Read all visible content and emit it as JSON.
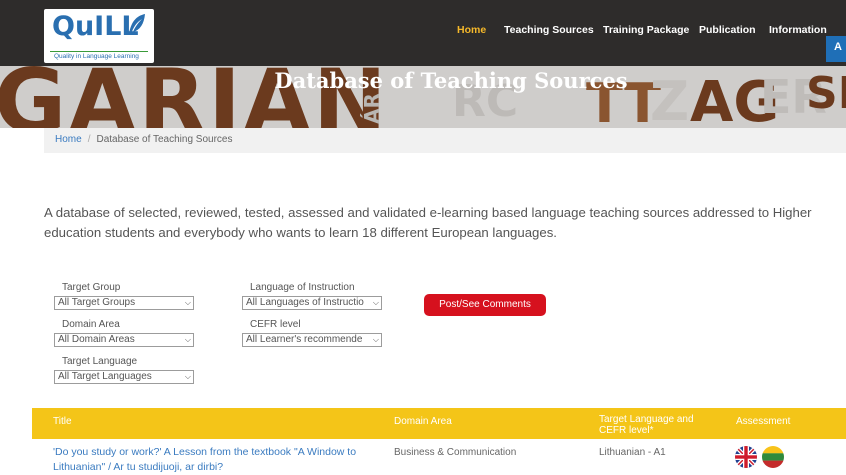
{
  "logo": {
    "name": "QuILL",
    "tagline": "Quality in Language Learning"
  },
  "nav": {
    "items": [
      {
        "label": "Home",
        "active": true
      },
      {
        "label": "Teaching Sources",
        "active": false
      },
      {
        "label": "Training Package",
        "active": false
      },
      {
        "label": "Publication",
        "active": false
      },
      {
        "label": "Information",
        "active": false
      }
    ],
    "login_label": "A"
  },
  "banner": {
    "title": "Database of Teaching Sources",
    "background_text": "GARIAN"
  },
  "breadcrumb": {
    "home": "Home",
    "separator": "/",
    "current": "Database of Teaching Sources"
  },
  "intro": "A database of selected, reviewed, tested, assessed and validated e-learning based language teaching sources addressed to Higher education students and everybody who wants to learn 18 different European languages.",
  "filters": {
    "target_group": {
      "label": "Target Group",
      "value": "All Target Groups"
    },
    "domain_area": {
      "label": "Domain Area",
      "value": "All Domain Areas"
    },
    "target_language": {
      "label": "Target Language",
      "value": "All Target Languages"
    },
    "language_of_instruction": {
      "label": "Language of Instruction",
      "value": "All Languages of Instructio"
    },
    "cefr_level": {
      "label": "CEFR level",
      "value": "All Learner's recommende"
    },
    "comments_button": "Post/See Comments"
  },
  "table": {
    "headers": {
      "title": "Title",
      "domain": "Domain Area",
      "target": "Target Language and CEFR level*",
      "assessment": "Assessment"
    },
    "rows": [
      {
        "title": "'Do you study or work?' A Lesson from the textbook \"A Window to Lithuanian\" / Ar tu studijuoji, ar dirbi?",
        "domain": "Business & Communication",
        "target": "Lithuanian - A1",
        "assessment_flags": [
          "uk-flag-icon",
          "lithuania-flag-icon"
        ]
      }
    ]
  },
  "colors": {
    "topbar": "#2e2c2b",
    "nav_active": "#f5b82a",
    "link": "#3a7bc0",
    "table_header": "#f4c518",
    "button_red": "#d6111e"
  }
}
